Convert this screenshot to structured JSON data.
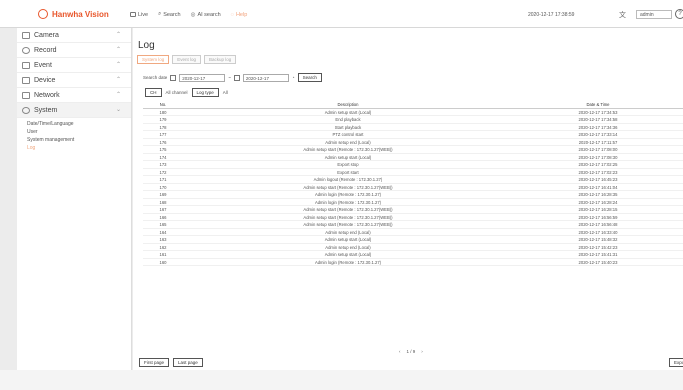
{
  "header": {
    "logo_text": "Hanwha Vision",
    "nav": [
      {
        "label": "Live",
        "icon": "monitor-icon"
      },
      {
        "label": "Search",
        "icon": "search-icon"
      },
      {
        "label": "AI search",
        "icon": "ai-search-icon"
      },
      {
        "label": "Help",
        "icon": "help-icon"
      }
    ],
    "datetime": "2020-12-17 17:38:59",
    "user": "admin",
    "help_glyph": "?"
  },
  "sidebar": {
    "items": [
      {
        "label": "Camera",
        "icon": "camera-icon"
      },
      {
        "label": "Record",
        "icon": "record-icon"
      },
      {
        "label": "Event",
        "icon": "event-icon"
      },
      {
        "label": "Device",
        "icon": "device-icon"
      },
      {
        "label": "Network",
        "icon": "network-icon"
      },
      {
        "label": "System",
        "icon": "gear-icon"
      }
    ],
    "system_sub": [
      "Date/Time/Language",
      "User",
      "System management",
      "Log"
    ]
  },
  "main": {
    "title": "Log",
    "tabs": [
      "System log",
      "Event log",
      "Backup log"
    ],
    "search": {
      "label": "Search date",
      "from": "2020-12-17",
      "to": "2020-12-17",
      "search_btn": "Search"
    },
    "filter": {
      "ch_btn": "CH",
      "ch_value": "All channel",
      "logtype_btn": "Log type",
      "logtype_value": "All"
    },
    "table": {
      "headers": [
        "No.",
        "Description",
        "Date & Time"
      ],
      "rows": [
        [
          "180",
          "Admin setup start (Local)",
          "2020-12-17 17:34:53"
        ],
        [
          "179",
          "End playback",
          "2020-12-17 17:34:58"
        ],
        [
          "178",
          "Start playback",
          "2020-12-17 17:34:36"
        ],
        [
          "177",
          "PTZ control start",
          "2020-12-17 17:33:14"
        ],
        [
          "176",
          "Admin setup end (Local)",
          "2020-12-17 17:11:57"
        ],
        [
          "175",
          "Admin setup start (Remote : 172.30.1.27(WEB))",
          "2020-12-17 17:08:00"
        ],
        [
          "174",
          "Admin setup start (Local)",
          "2020-12-17 17:08:30"
        ],
        [
          "173",
          "Export stop",
          "2020-12-17 17:02:25"
        ],
        [
          "172",
          "Export start",
          "2020-12-17 17:02:23"
        ],
        [
          "171",
          "Admin logout (Remote : 172.30.1.27)",
          "2020-12-17 16:45:23"
        ],
        [
          "170",
          "Admin setup start (Remote : 172.30.1.27(WEB))",
          "2020-12-17 16:41:04"
        ],
        [
          "169",
          "Admin login (Remote : 172.30.1.27)",
          "2020-12-17 16:28:35"
        ],
        [
          "168",
          "Admin login (Remote : 172.30.1.27)",
          "2020-12-17 16:28:24"
        ],
        [
          "167",
          "Admin setup start (Remote : 172.30.1.27(WEB))",
          "2020-12-17 16:28:15"
        ],
        [
          "166",
          "Admin setup start (Remote : 172.30.1.27(WEB))",
          "2020-12-17 16:56:59"
        ],
        [
          "165",
          "Admin setup start (Remote : 172.30.1.27(WEB))",
          "2020-12-17 16:56:48"
        ],
        [
          "164",
          "Admin setup end (Local)",
          "2020-12-17 16:33:40"
        ],
        [
          "163",
          "Admin setup start (Local)",
          "2020-12-17 15:48:32"
        ],
        [
          "162",
          "Admin setup end (Local)",
          "2020-12-17 15:42:23"
        ],
        [
          "161",
          "Admin setup start (Local)",
          "2020-12-17 15:41:31"
        ],
        [
          "160",
          "Admin login (Remote : 172.30.1.27)",
          "2020-12-17 15:40:23"
        ]
      ]
    },
    "pager": {
      "prev": "‹",
      "page": "1 / 9",
      "next": "›"
    },
    "first_page": "First page",
    "last_page": "Last page",
    "export": "Export"
  },
  "colors": {
    "accent": "#e8562b",
    "accent_light": "#f0a880"
  }
}
